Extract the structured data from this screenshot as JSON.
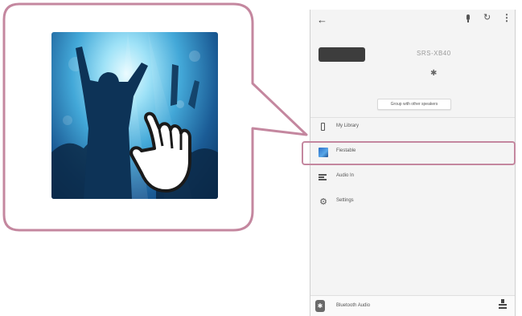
{
  "phone": {
    "device_name": "SRS-XB40",
    "group_button": "Group with other speakers",
    "menu": [
      {
        "label": "My Library",
        "icon": "phone-icon"
      },
      {
        "label": "Fiestable",
        "icon": "music-app-icon"
      },
      {
        "label": "Audio In",
        "icon": "audio-in-icon"
      },
      {
        "label": "Settings",
        "icon": "gear-icon"
      }
    ],
    "bottom_bar": {
      "label": "Bluetooth Audio"
    }
  },
  "colors": {
    "highlight": "#c4879f",
    "phone_bg": "#f4f4f4",
    "art_blue": "#43a8d8"
  },
  "icons": [
    "back-arrow-icon",
    "microphone-icon",
    "refresh-icon",
    "more-options-icon",
    "bluetooth-icon",
    "volume-slider-icon",
    "tap-hand-icon"
  ]
}
